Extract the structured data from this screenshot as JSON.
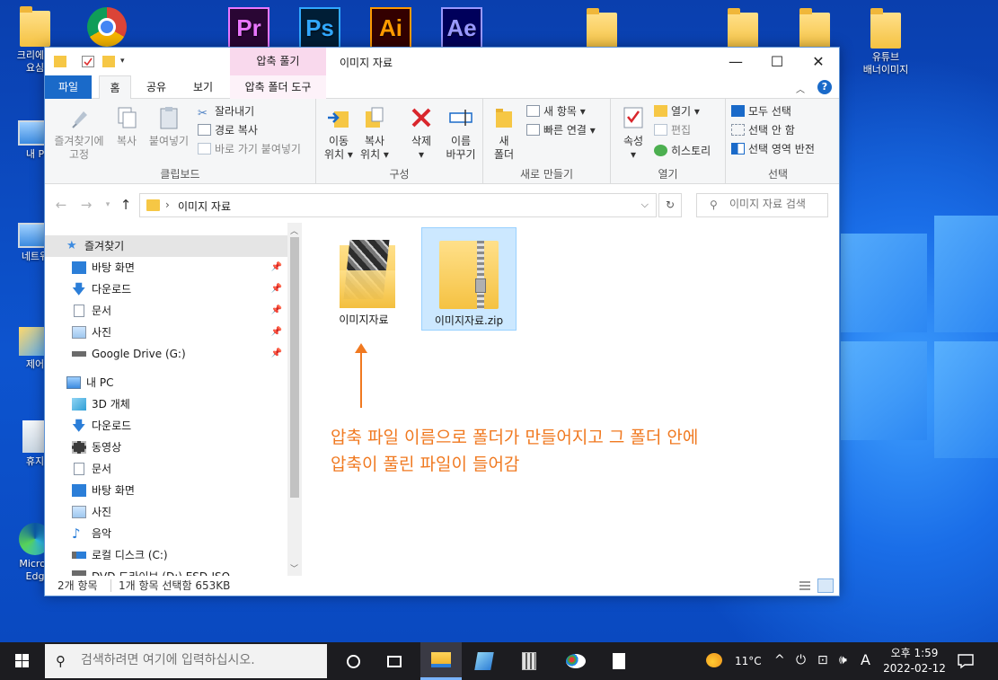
{
  "desktop": {
    "icons_left": [
      {
        "label": "크리에이\n요심"
      },
      {
        "label": "내 P"
      },
      {
        "label": "네트워"
      },
      {
        "label": "제어"
      },
      {
        "label": "휴지"
      },
      {
        "label": "Micros\nEdg"
      }
    ],
    "apps_top": [
      {
        "name": "Pr",
        "color": "#ea77ff",
        "bg": "#2a0634"
      },
      {
        "name": "Ps",
        "color": "#31a8ff",
        "bg": "#001e36"
      },
      {
        "name": "Ai",
        "color": "#ff9a00",
        "bg": "#330000"
      },
      {
        "name": "Ae",
        "color": "#9999ff",
        "bg": "#00005b"
      }
    ],
    "folder_label": "유튜브\n배너이미지"
  },
  "window": {
    "title": "이미지 자료",
    "context_tab_header": "압축 풀기",
    "controls": {
      "minimize": "—",
      "maximize": "☐",
      "close": "✕"
    }
  },
  "tabs": {
    "file": "파일",
    "home": "홈",
    "share": "공유",
    "view": "보기",
    "tools": "압축 폴더 도구"
  },
  "ribbon": {
    "clipboard": {
      "label": "클립보드",
      "pin": "즐겨찾기에\n고정",
      "copy": "복사",
      "paste": "붙여넣기",
      "cut": "잘라내기",
      "copy_path": "경로 복사",
      "paste_shortcut": "바로 가기 붙여넣기"
    },
    "organize": {
      "label": "구성",
      "move": "이동\n위치 ▾",
      "copyto": "복사\n위치 ▾",
      "delete": "삭제\n▾",
      "rename": "이름\n바꾸기"
    },
    "new": {
      "label": "새로 만들기",
      "new_folder": "새\n폴더",
      "new_item": "새 항목 ▾",
      "easy_access": "빠른 연결 ▾"
    },
    "open": {
      "label": "열기",
      "properties": "속성\n▾",
      "open": "열기 ▾",
      "edit": "편집",
      "history": "히스토리"
    },
    "select": {
      "label": "선택",
      "select_all": "모두 선택",
      "select_none": "선택 안 함",
      "invert": "선택 영역 반전"
    }
  },
  "address": {
    "path": "이미지 자료",
    "separator": "›",
    "search_placeholder": "이미지 자료 검색"
  },
  "nav": {
    "quick_access": "즐겨찾기",
    "quick_items": [
      "바탕 화면",
      "다운로드",
      "문서",
      "사진",
      "Google Drive (G:)"
    ],
    "this_pc": "내 PC",
    "pc_items": [
      "3D 개체",
      "다운로드",
      "동영상",
      "문서",
      "바탕 화면",
      "사진",
      "음악",
      "로컬 디스크 (C:)",
      "DVD 드라이브 (D:) ESD-ISO"
    ]
  },
  "files": [
    {
      "name": "이미지자료",
      "type": "folder",
      "selected": false
    },
    {
      "name": "이미지자료.zip",
      "type": "zip",
      "selected": true
    }
  ],
  "annotation": {
    "line1": "압축 파일 이름으로 폴더가 만들어지고 그 폴더 안에",
    "line2": "압축이 풀린 파일이 들어감",
    "color": "#f07920"
  },
  "status": {
    "count": "2개 항목",
    "selection": "1개 항목 선택함 653KB"
  },
  "taskbar": {
    "search_placeholder": "검색하려면 여기에 입력하십시오.",
    "weather": "11°C",
    "ime": "A",
    "time": "오후 1:59",
    "date": "2022-02-12"
  }
}
